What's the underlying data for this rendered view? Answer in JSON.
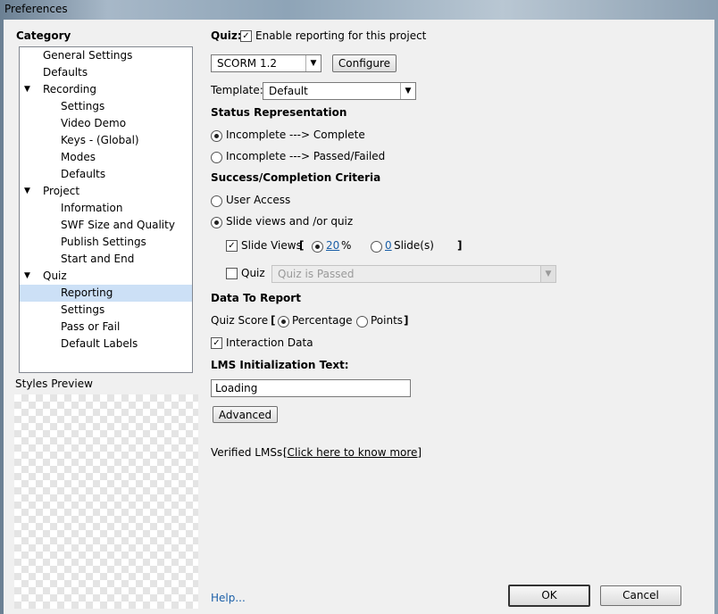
{
  "window": {
    "title": "Preferences"
  },
  "sidebar": {
    "category_label": "Category",
    "items": [
      {
        "label": "General Settings",
        "level": 0,
        "expanded": null
      },
      {
        "label": "Defaults",
        "level": 0,
        "expanded": null
      },
      {
        "label": "Recording",
        "level": 0,
        "expanded": true
      },
      {
        "label": "Settings",
        "level": 1,
        "expanded": null
      },
      {
        "label": "Video Demo",
        "level": 1,
        "expanded": null
      },
      {
        "label": "Keys - (Global)",
        "level": 1,
        "expanded": null
      },
      {
        "label": "Modes",
        "level": 1,
        "expanded": null
      },
      {
        "label": "Defaults",
        "level": 1,
        "expanded": null
      },
      {
        "label": "Project",
        "level": 0,
        "expanded": true
      },
      {
        "label": "Information",
        "level": 1,
        "expanded": null
      },
      {
        "label": "SWF Size and Quality",
        "level": 1,
        "expanded": null
      },
      {
        "label": "Publish Settings",
        "level": 1,
        "expanded": null
      },
      {
        "label": "Start and End",
        "level": 1,
        "expanded": null
      },
      {
        "label": "Quiz",
        "level": 0,
        "expanded": true
      },
      {
        "label": "Reporting",
        "level": 1,
        "expanded": null,
        "selected": true
      },
      {
        "label": "Settings",
        "level": 1,
        "expanded": null
      },
      {
        "label": "Pass or Fail",
        "level": 1,
        "expanded": null
      },
      {
        "label": "Default Labels",
        "level": 1,
        "expanded": null
      }
    ],
    "expand_glyph": "▼",
    "styles_preview_label": "Styles Preview"
  },
  "quiz": {
    "label": "Quiz:",
    "enable_label": "Enable reporting for this project",
    "enable_checked": true,
    "standard_value": "SCORM 1.2",
    "configure_label": "Configure",
    "template_label": "Template:",
    "template_value": "Default"
  },
  "status": {
    "heading": "Status Representation",
    "options": [
      "Incomplete ---> Complete",
      "Incomplete ---> Passed/Failed"
    ],
    "selected": 0
  },
  "criteria": {
    "heading": "Success/Completion Criteria",
    "user_access_label": "User Access",
    "slide_views_quiz_label": "Slide views and /or quiz",
    "selected": 1,
    "slide_views_label": "Slide Views",
    "slide_views_checked": true,
    "open_bracket": "[",
    "close_bracket": "]",
    "percent_value": "20",
    "percent_unit": "%",
    "slides_value": "0",
    "slides_unit": "Slide(s)",
    "quiz_label": "Quiz",
    "quiz_checked": false,
    "quiz_option": "Quiz is Passed"
  },
  "data_to_report": {
    "heading": "Data To Report",
    "quiz_score_label": "Quiz Score",
    "open_bracket": "[",
    "close_bracket": "]",
    "percentage_label": "Percentage",
    "points_label": "Points",
    "score_selected": "Percentage",
    "interaction_label": "Interaction Data",
    "interaction_checked": true
  },
  "lms": {
    "heading": "LMS Initialization Text:",
    "value": "Loading",
    "advanced_label": "Advanced",
    "verified_label": "Verified LMSs:",
    "verified_link": "[Click here to know more]"
  },
  "footer": {
    "help_label": "Help...",
    "ok_label": "OK",
    "cancel_label": "Cancel"
  },
  "colors": {
    "accent": "#1b5fa8",
    "selection": "#cce0f6",
    "dialog_bg": "#f0f0f0"
  },
  "icons": {
    "checkmark": "✓",
    "dropdown": "▼"
  }
}
